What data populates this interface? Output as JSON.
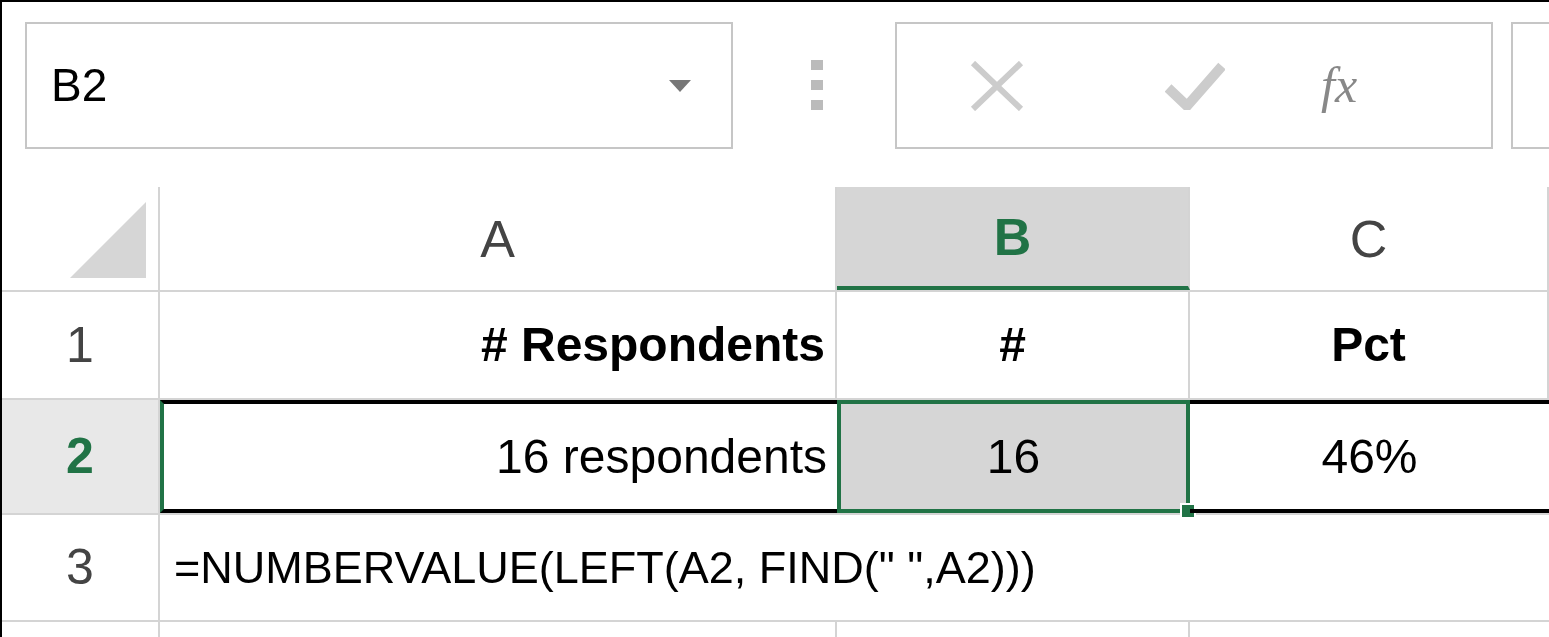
{
  "name_box": {
    "value": "B2"
  },
  "formula_bar": {
    "function_label": "fx"
  },
  "columns": [
    {
      "label": "A",
      "selected": false
    },
    {
      "label": "B",
      "selected": true
    },
    {
      "label": "C",
      "selected": false
    }
  ],
  "rows": [
    {
      "header": "1",
      "kind": "header",
      "selected": false,
      "cells": [
        {
          "text": "# Respondents",
          "selected": false
        },
        {
          "text": "#",
          "selected": false
        },
        {
          "text": "Pct",
          "selected": false
        }
      ]
    },
    {
      "header": "2",
      "kind": "data",
      "selected": true,
      "cells": [
        {
          "text": "16 respondents",
          "selected": false
        },
        {
          "text": "16",
          "selected": true
        },
        {
          "text": "46%",
          "selected": false
        }
      ]
    },
    {
      "header": "3",
      "kind": "formula",
      "selected": false,
      "cells": [
        {
          "text": "=NUMBERVALUE(LEFT(A2, FIND(\" \",A2)))",
          "selected": false
        }
      ]
    }
  ]
}
